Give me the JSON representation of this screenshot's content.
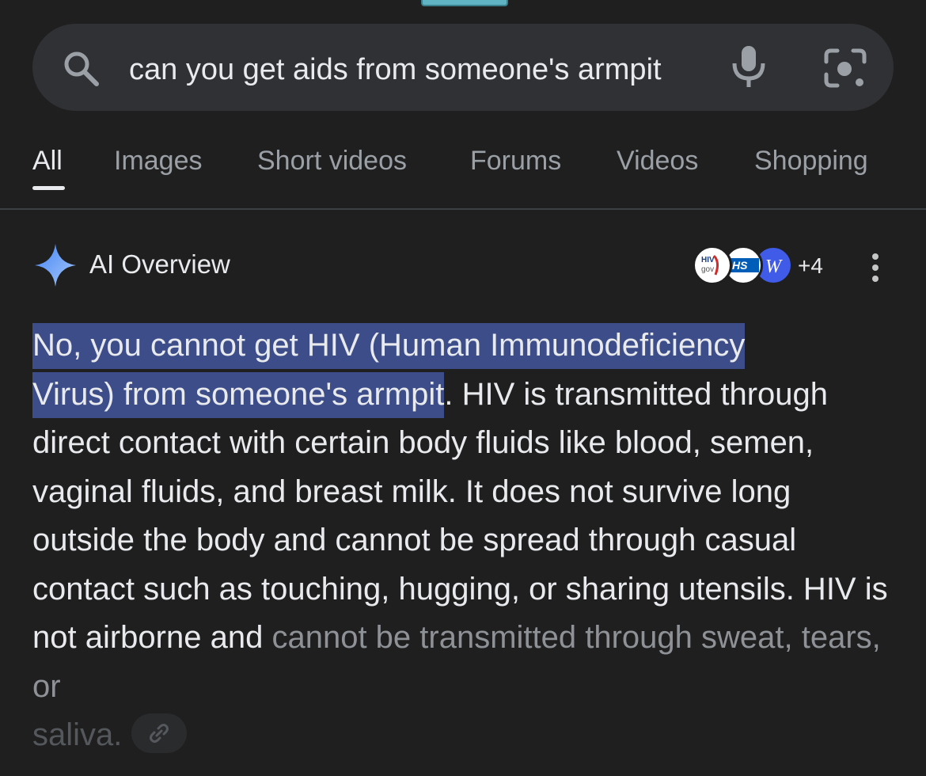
{
  "search": {
    "query": "can you get aids from someone's armpit"
  },
  "tabs": [
    {
      "label": "All",
      "active": true
    },
    {
      "label": "Images"
    },
    {
      "label": "Short videos"
    },
    {
      "label": "Forums"
    },
    {
      "label": "Videos"
    },
    {
      "label": "Shopping"
    }
  ],
  "ai_overview": {
    "title": "AI Overview",
    "sources": [
      {
        "icon": "hiv-gov-logo",
        "text": "HIV gov"
      },
      {
        "icon": "nhs-logo",
        "text": "HS"
      },
      {
        "icon": "wikipedia-logo",
        "text": "W"
      }
    ],
    "more_sources": "+4",
    "highlight_line1": "No, you cannot get HIV (Human Immunodeficiency",
    "highlight_line2": "Virus) from someone's armpit",
    "body": ". HIV is transmitted through direct contact with certain body fluids like blood, semen, vaginal fluids, and breast milk. It does not survive long outside the body and cannot be spread through casual contact such as touching, hugging, or sharing utensils. HIV is not airborne and ",
    "faded_1": "cannot be transmitted through sweat, tears, or",
    "faded_2": "saliva."
  },
  "colors": {
    "background": "#1f1f1f",
    "search_bar": "#303134",
    "highlight": "#3c4d8a",
    "sparkle": "#8ab4f8"
  }
}
